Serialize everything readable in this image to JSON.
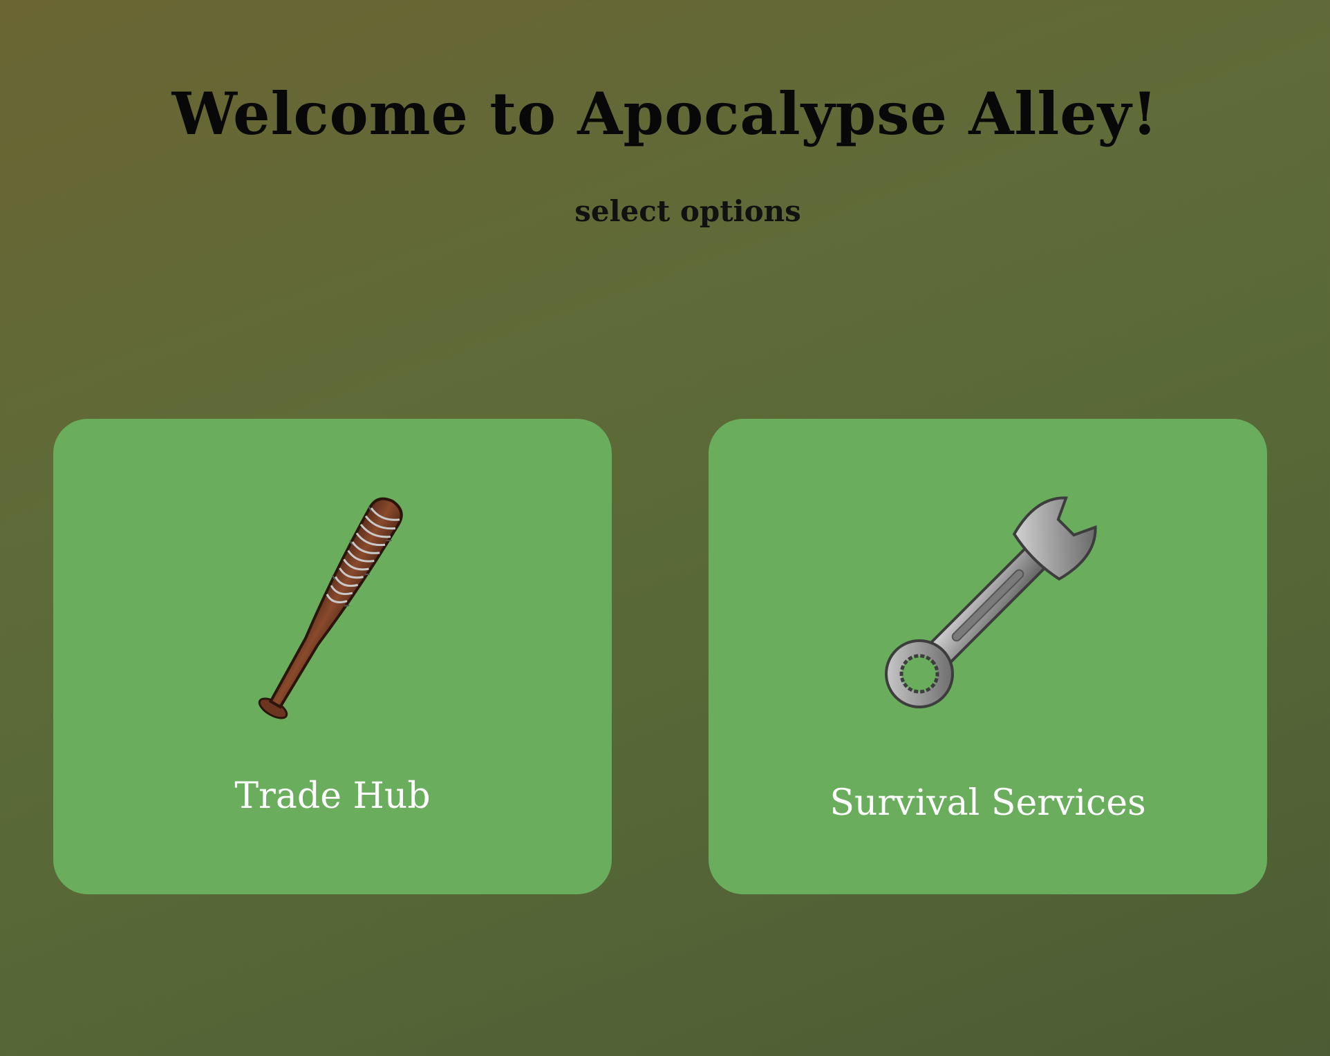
{
  "header": {
    "title": "Welcome to Apocalypse Alley!",
    "subtitle": "select options"
  },
  "options": [
    {
      "label": "Trade Hub",
      "icon": "baseball-bat-icon"
    },
    {
      "label": "Survival Services",
      "icon": "wrench-icon"
    }
  ],
  "colors": {
    "background_start": "#6a6533",
    "background_end": "#4d5b34",
    "card": "#69ad5d",
    "card_text": "#ffffff",
    "title_text": "#080808"
  }
}
